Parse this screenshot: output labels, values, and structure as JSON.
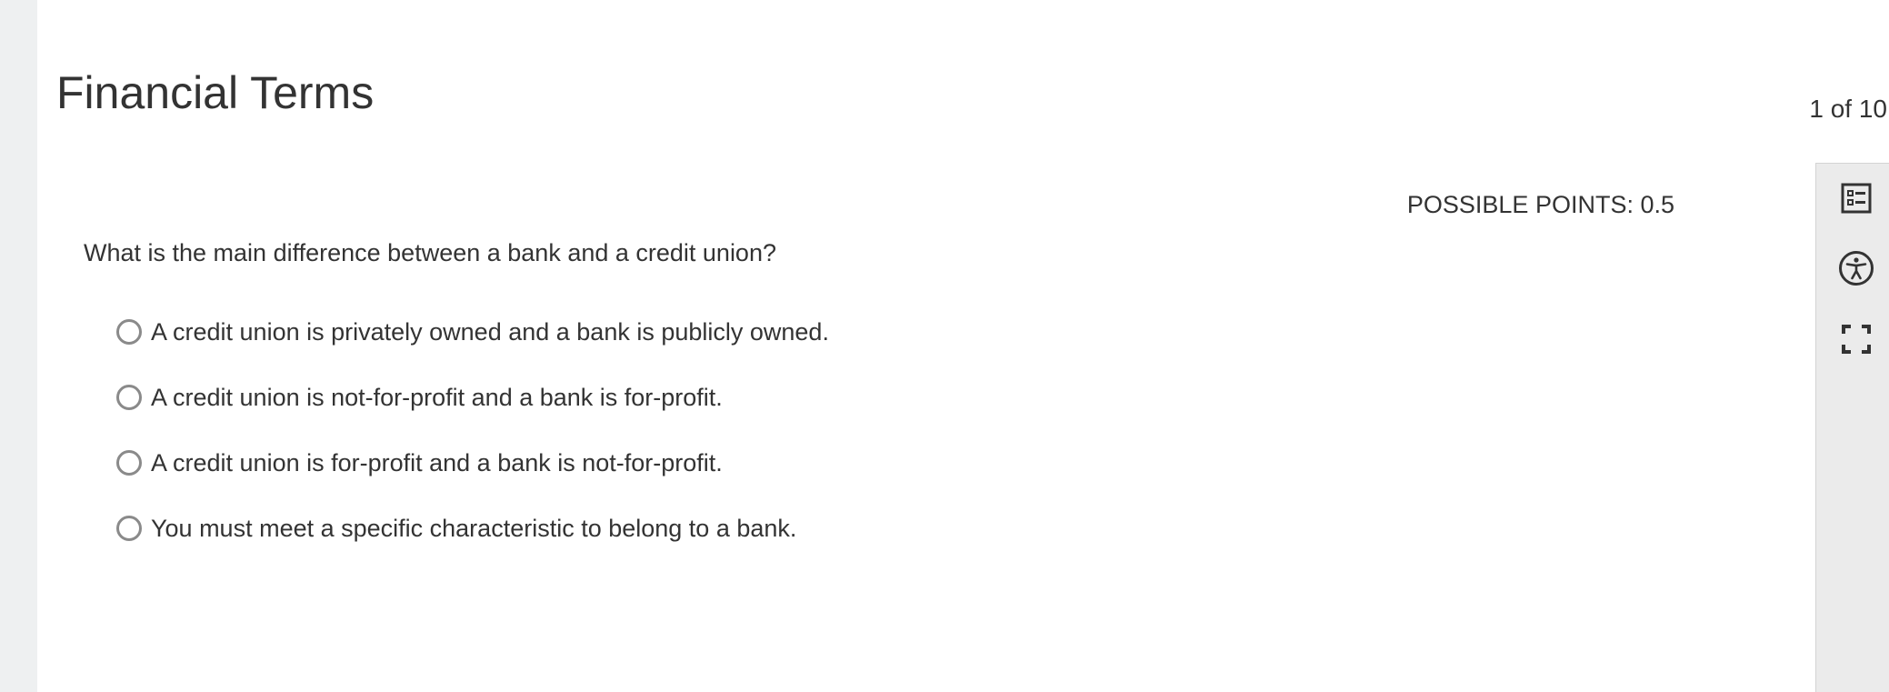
{
  "quiz": {
    "title": "Financial Terms",
    "counter": "1 of 10"
  },
  "question": {
    "points_label": "POSSIBLE POINTS: 0.5",
    "prompt": "What is the main difference between a bank and a credit union?",
    "choices": [
      "A credit union is privately owned and a bank is publicly owned.",
      "A credit union is not-for-profit and a bank is for-profit.",
      "A credit union is for-profit and a bank is not-for-profit.",
      "You must meet a specific characteristic to belong to a bank."
    ],
    "selected": null
  },
  "toolbar": {
    "icons": [
      "question-list-icon",
      "accessibility-icon",
      "fullscreen-icon"
    ]
  }
}
